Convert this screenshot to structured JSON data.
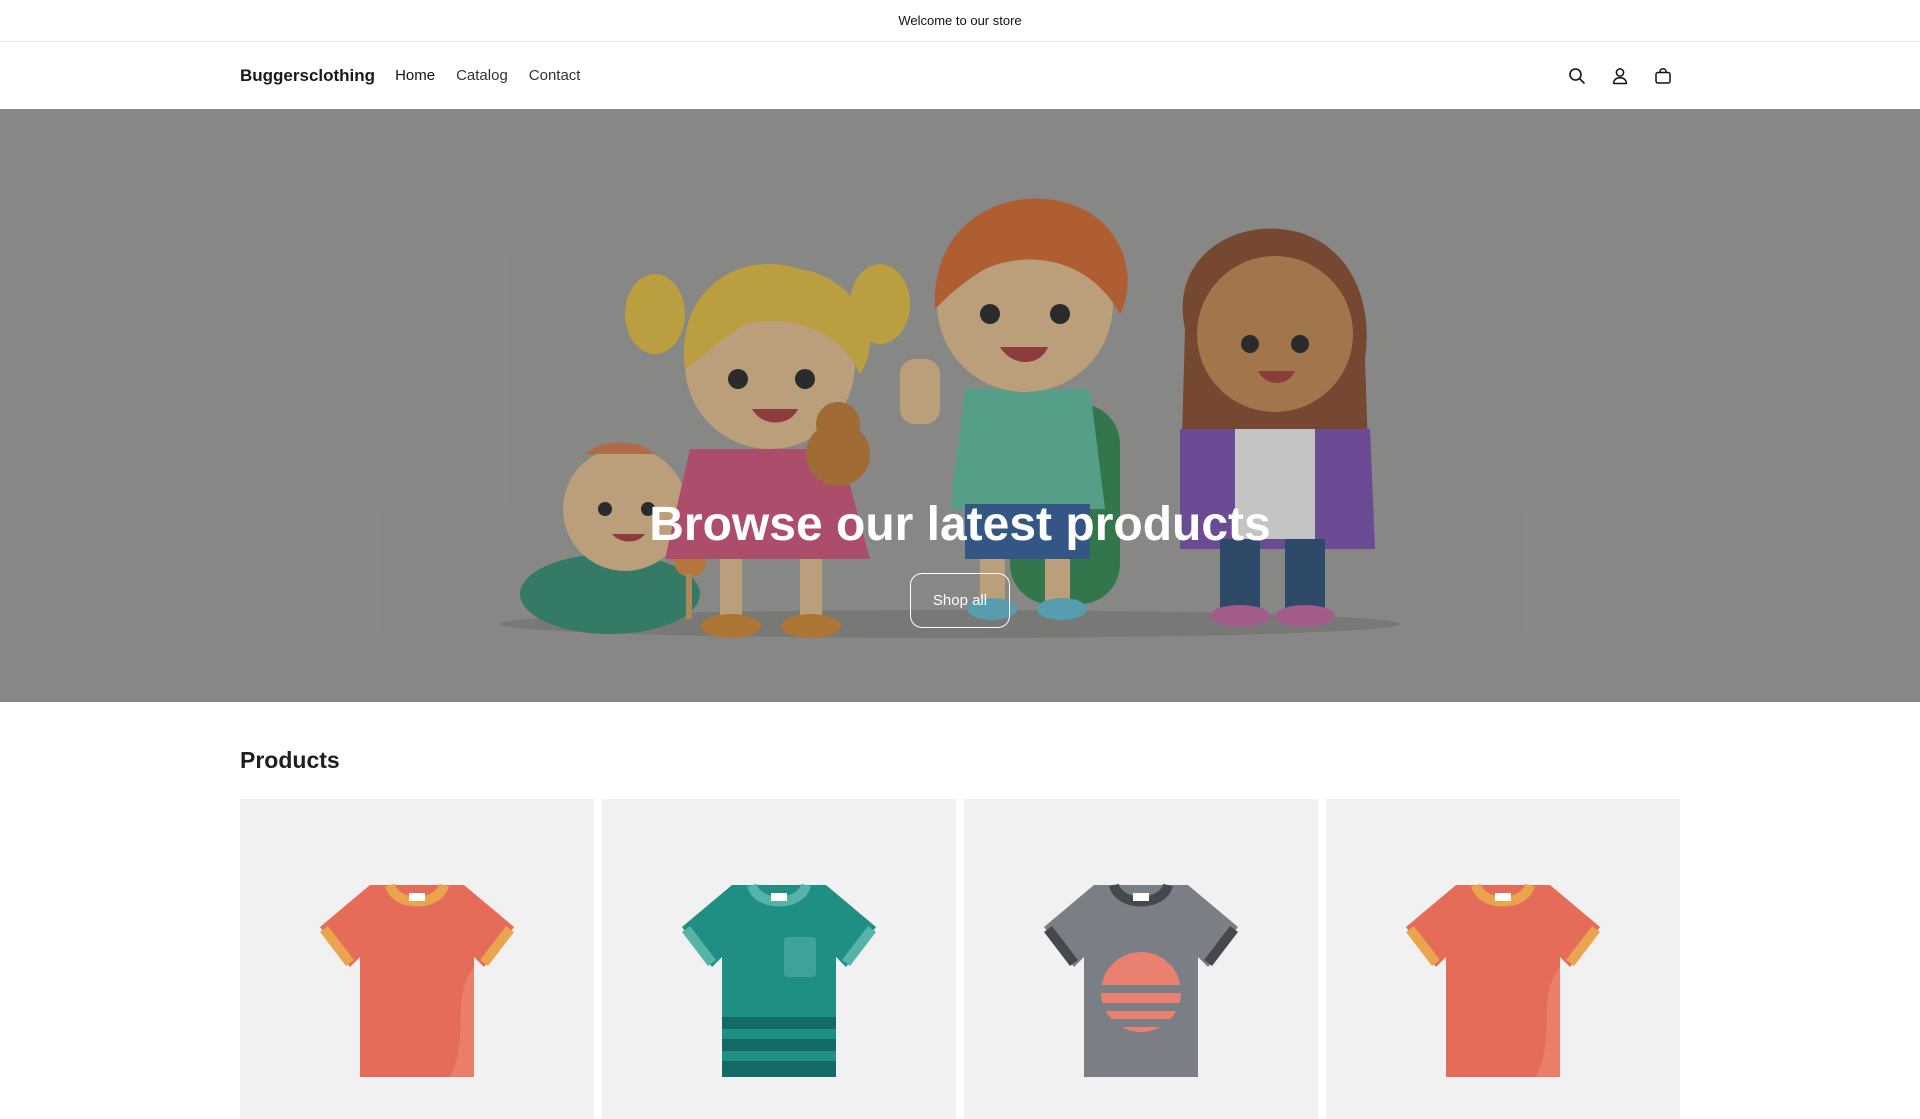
{
  "announcement": {
    "text": "Welcome to our store"
  },
  "header": {
    "brand": "Buggersclothing",
    "nav": [
      {
        "label": "Home"
      },
      {
        "label": "Catalog"
      },
      {
        "label": "Contact"
      }
    ],
    "icons": [
      "search-icon",
      "account-icon",
      "cart-icon"
    ]
  },
  "hero": {
    "title": "Browse our latest products",
    "button_label": "Shop all"
  },
  "products": {
    "heading": "Products",
    "items": [
      {
        "image": "t-shirt-icon",
        "color": "#e46c58",
        "accent": "#eaa44d"
      },
      {
        "image": "t-shirt-icon",
        "color": "#1f8f84",
        "accent": "#55b3a8"
      },
      {
        "image": "t-shirt-icon",
        "color": "#7a7f86",
        "accent": "#45494e"
      },
      {
        "image": "t-shirt-icon",
        "color": "#e46c58",
        "accent": "#eaa44d"
      }
    ]
  },
  "colors": {
    "hero_background": "#a1a1a0",
    "card_background": "#f1f1f1",
    "text": "#121212"
  }
}
